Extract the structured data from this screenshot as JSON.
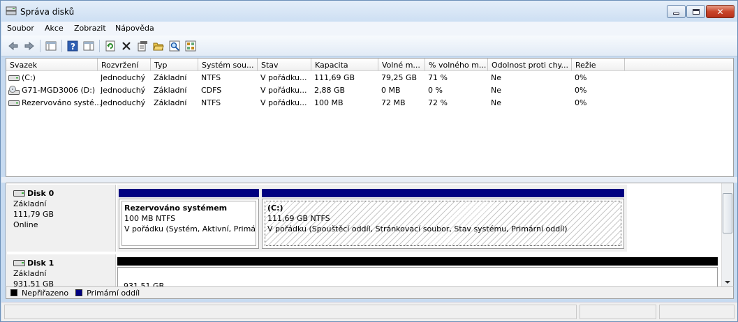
{
  "window": {
    "title": "Správa disků"
  },
  "menu": [
    "Soubor",
    "Akce",
    "Zobrazit",
    "Nápověda"
  ],
  "toolbar": {
    "buttons": [
      "back-arrow-icon",
      "forward-arrow-icon",
      "console-tree-icon",
      "help-icon",
      "properties-pane-icon",
      "refresh-icon",
      "delete-icon",
      "properties-icon",
      "open-folder-icon",
      "explore-icon",
      "action-pane-icon"
    ]
  },
  "volumes": {
    "columns": [
      "Svazek",
      "Rozvržení",
      "Typ",
      "Systém sou...",
      "Stav",
      "Kapacita",
      "Volné m...",
      "% volného m...",
      "Odolnost proti chy...",
      "Režie"
    ],
    "rows": [
      [
        "(C:)",
        "Jednoduchý",
        "Základní",
        "NTFS",
        "V pořádku...",
        "111,69 GB",
        "79,25 GB",
        "71 %",
        "Ne",
        "0%"
      ],
      [
        "G71-MGD3006 (D:)",
        "Jednoduchý",
        "Základní",
        "CDFS",
        "V pořádku...",
        "2,88 GB",
        "0 MB",
        "0 %",
        "Ne",
        "0%"
      ],
      [
        "Rezervováno systé...",
        "Jednoduchý",
        "Základní",
        "NTFS",
        "V pořádku...",
        "100 MB",
        "72 MB",
        "72 %",
        "Ne",
        "0%"
      ]
    ]
  },
  "disks": [
    {
      "name": "Disk 0",
      "type": "Základní",
      "size": "111,79 GB",
      "status": "Online",
      "partitions": [
        {
          "title": "Rezervováno systémem",
          "size_fs": "100 MB NTFS",
          "status": "V pořádku (Systém, Aktivní, Primárn"
        },
        {
          "title": "(C:)",
          "size_fs": "111,69 GB NTFS",
          "status": "V pořádku (Spouštěcí oddíl, Stránkovací soubor, Stav systému, Primární oddíl)"
        }
      ]
    },
    {
      "name": "Disk 1",
      "type": "Základní",
      "size": "931,51 GB",
      "partitions": [
        {
          "size_fs": "931,51 GB"
        }
      ]
    }
  ],
  "legend": {
    "items": [
      {
        "label": "Nepřiřazeno",
        "color": "#000000"
      },
      {
        "label": "Primární oddíl",
        "color": "#000080"
      }
    ]
  },
  "colors": {
    "primary_partition": "#000080",
    "unallocated": "#000000",
    "title_bg": "#c7dbf1",
    "close_button": "#c9452b"
  }
}
